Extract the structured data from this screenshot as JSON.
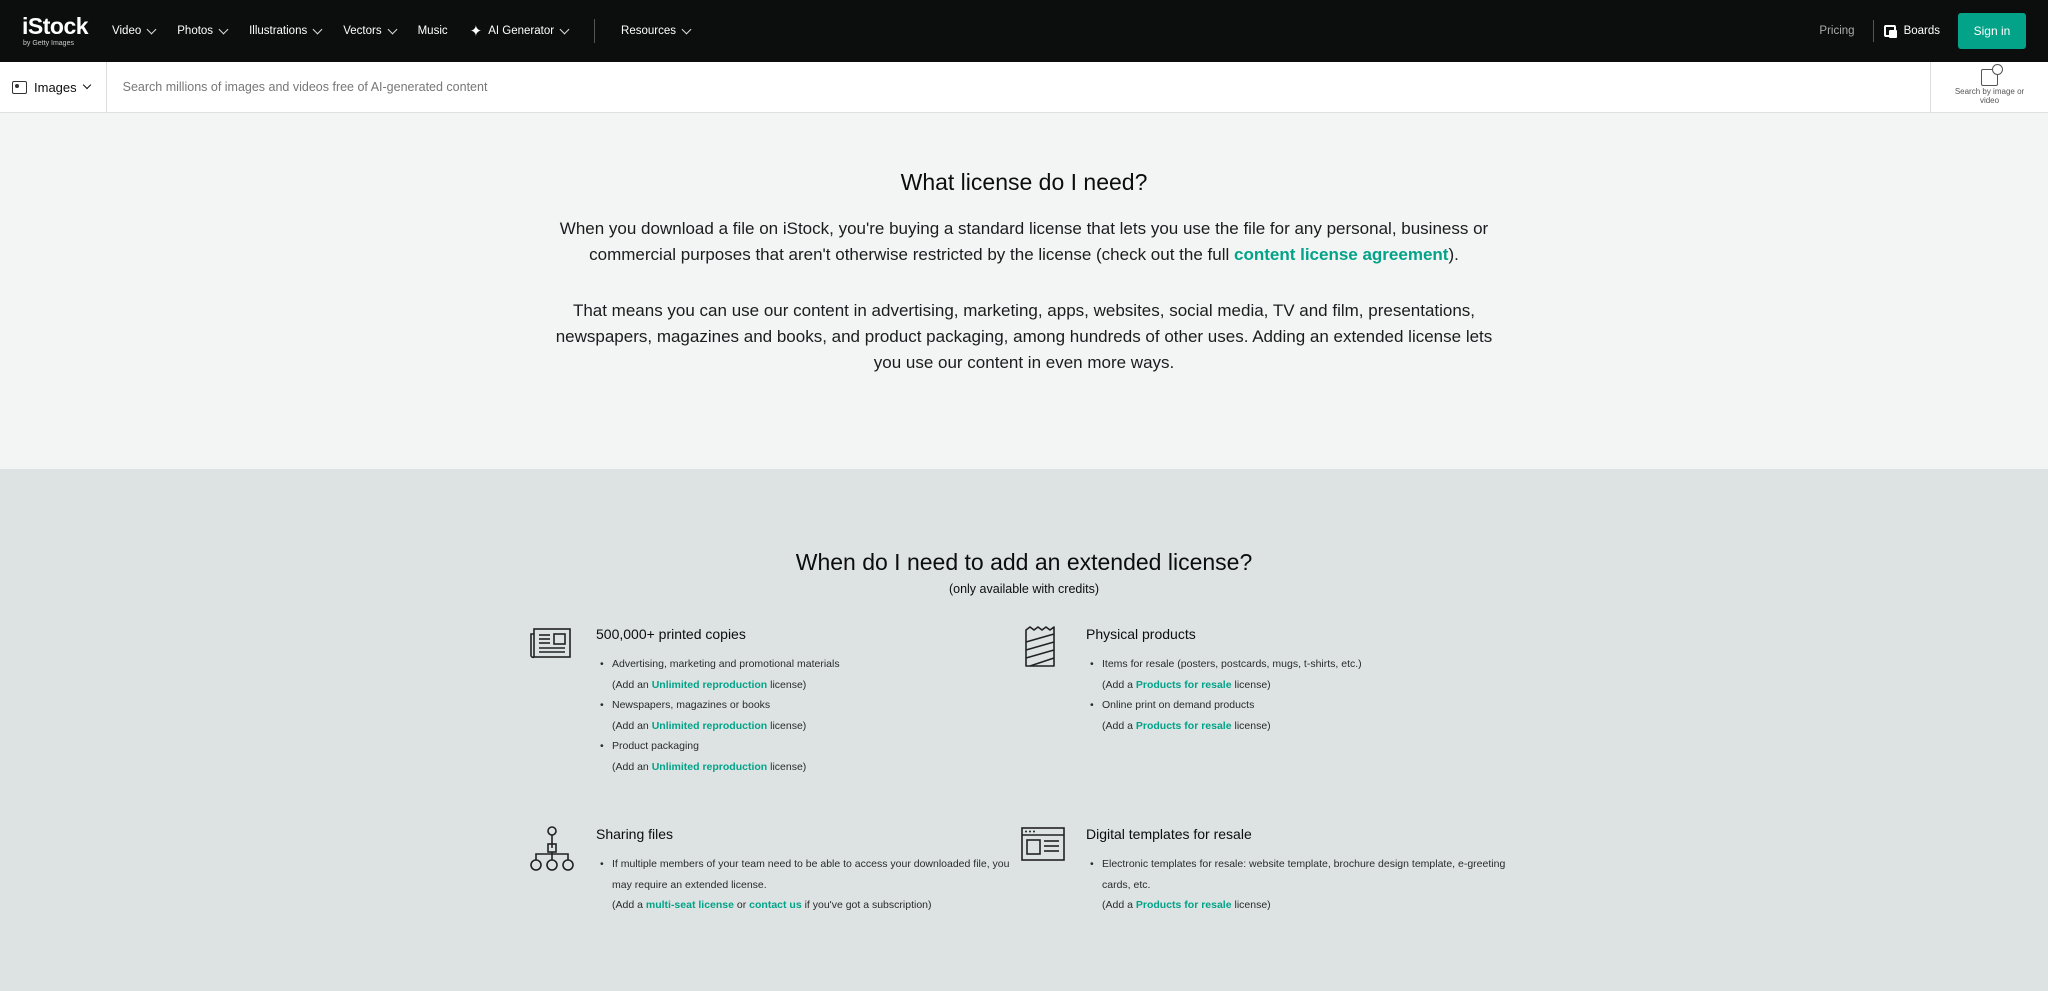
{
  "nav": {
    "logo": "iStock",
    "logo_sub": "by Getty Images",
    "items": [
      "Video",
      "Photos",
      "Illustrations",
      "Vectors",
      "Music",
      "AI Generator",
      "Resources"
    ],
    "pricing": "Pricing",
    "boards": "Boards",
    "signin": "Sign in"
  },
  "search": {
    "type": "Images",
    "placeholder": "Search millions of images and videos free of AI-generated content",
    "visual_search": "Search by image or video"
  },
  "section1": {
    "title": "What license do I need?",
    "p1_before": "When you download a file on iStock, you're buying a standard license that lets you use the file for any personal, business or commercial purposes that aren't otherwise restricted by the license (check out the full ",
    "p1_link": "content license agreement",
    "p1_after": ").",
    "p2": "That means you can use our content in advertising, marketing, apps, websites, social media, TV and film, presentations, newspapers, magazines and books, and product packaging, among hundreds of other uses. Adding an extended license lets you use our content in even more ways."
  },
  "section2": {
    "title": "When do I need to add an extended license?",
    "subtitle": "(only available with credits)",
    "printed": {
      "title": "500,000+ printed copies",
      "items": [
        {
          "text": "Advertising, marketing and promotional materials",
          "add": "(Add an ",
          "link": "Unlimited reproduction",
          "after": " license)"
        },
        {
          "text": "Newspapers, magazines or books",
          "add": "(Add an ",
          "link": "Unlimited reproduction",
          "after": " license)"
        },
        {
          "text": "Product packaging",
          "add": "(Add an ",
          "link": "Unlimited reproduction",
          "after": " license)"
        }
      ]
    },
    "physical": {
      "title": "Physical products",
      "items": [
        {
          "text": "Items for resale (posters, postcards, mugs, t-shirts, etc.)",
          "add": "(Add a ",
          "link": "Products for resale",
          "after": " license)"
        },
        {
          "text": "Online print on demand products",
          "add": "(Add a ",
          "link": "Products for resale",
          "after": " license)"
        }
      ]
    },
    "sharing": {
      "title": "Sharing files",
      "text": "If multiple members of your team need to be able to access your downloaded file, you may require an extended license.",
      "add": "(Add a ",
      "link1": "multi-seat license",
      "mid": " or ",
      "link2": "contact us",
      "after": " if you've got a subscription)"
    },
    "digital": {
      "title": "Digital templates for resale",
      "text": "Electronic templates for resale: website template, brochure design template, e-greeting cards, etc.",
      "add": "(Add a ",
      "link": "Products for resale",
      "after": " license)"
    }
  }
}
